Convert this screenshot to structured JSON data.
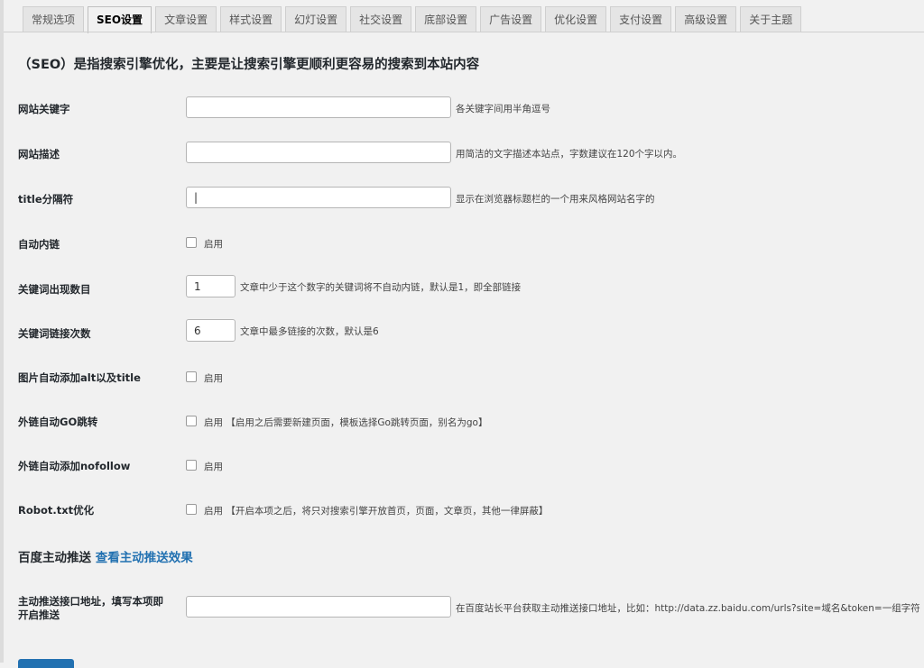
{
  "tabs": [
    "常规选项",
    "SEO设置",
    "文章设置",
    "样式设置",
    "幻灯设置",
    "社交设置",
    "底部设置",
    "广告设置",
    "优化设置",
    "支付设置",
    "高级设置",
    "关于主题"
  ],
  "heading": "（SEO）是指搜索引擎优化，主要是让搜索引擎更顺利更容易的搜索到本站内容",
  "fields": {
    "keywords": {
      "label": "网站关键字",
      "value": "",
      "desc": "各关键字间用半角逗号"
    },
    "description": {
      "label": "网站描述",
      "value": "",
      "desc": "用简洁的文字描述本站点，字数建议在120个字以内。"
    },
    "title_sep": {
      "label": "title分隔符",
      "value": "|",
      "desc": "显示在浏览器标题栏的一个用来风格网站名字的"
    },
    "auto_link": {
      "label": "自动内链",
      "cb_label": "启用"
    },
    "kw_count": {
      "label": "关键词出现数目",
      "value": "1",
      "desc": "文章中少于这个数字的关键词将不自动内链，默认是1，即全部链接"
    },
    "kw_link_times": {
      "label": "关键词链接次数",
      "value": "6",
      "desc": "文章中最多链接的次数，默认是6"
    },
    "img_alt": {
      "label": "图片自动添加alt以及title",
      "cb_label": "启用"
    },
    "go_redirect": {
      "label": "外链自动GO跳转",
      "cb_label": "启用 【启用之后需要新建页面，模板选择Go跳转页面，别名为go】"
    },
    "nofollow": {
      "label": "外链自动添加nofollow",
      "cb_label": "启用"
    },
    "robots": {
      "label": "Robot.txt优化",
      "cb_label": "启用 【开启本项之后，将只对搜索引擎开放首页，页面，文章页，其他一律屏蔽】"
    }
  },
  "baidu": {
    "title": "百度主动推送",
    "link_text": "查看主动推送效果",
    "api_label_line1": "主动推送接口地址，填写本项即",
    "api_label_line2": "开启推送",
    "api_value": "",
    "api_desc": "在百度站长平台获取主动推送接口地址，比如：http://data.zz.baidu.com/urls?site=域名&token=一组字符"
  }
}
